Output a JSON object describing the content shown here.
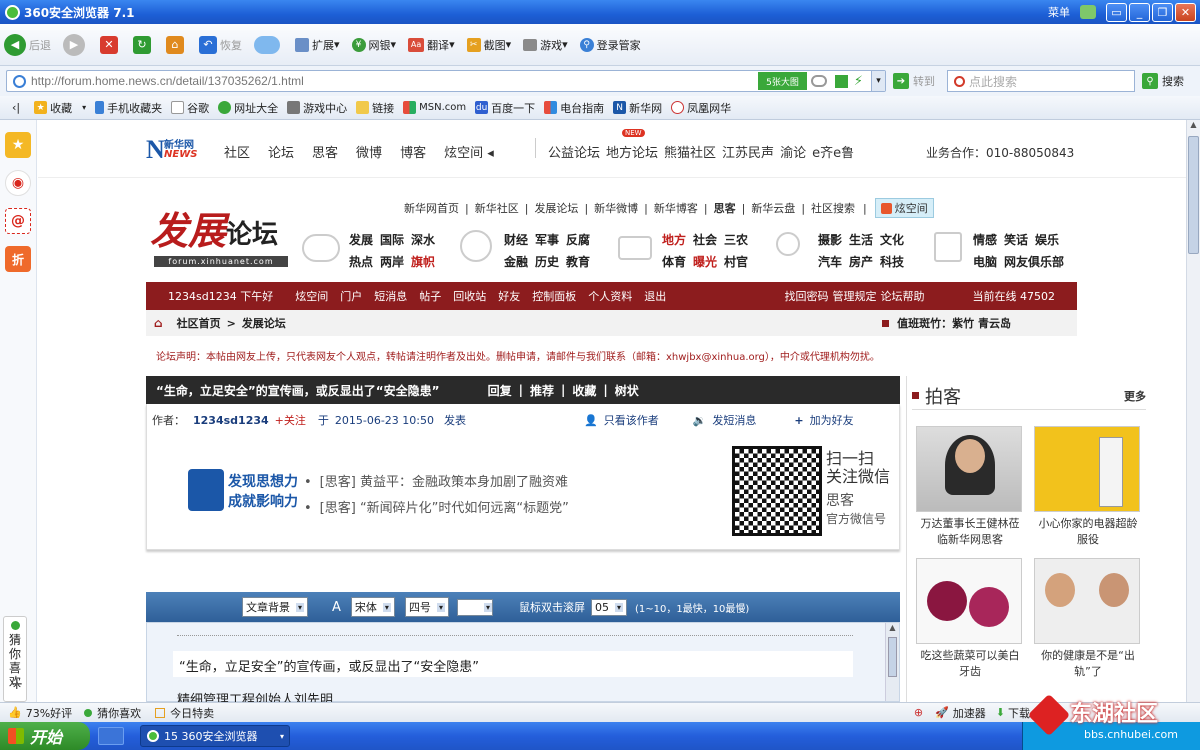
{
  "window": {
    "title": "360安全浏览器 7.1",
    "menu_label": "菜单"
  },
  "toolbar": {
    "back": "后退",
    "restore": "恢复",
    "extend": "扩展",
    "netbank": "网银",
    "translate": "翻译",
    "screenshot": "截图",
    "games": "游戏",
    "login": "登录管家"
  },
  "address": {
    "url": "http://forum.home.news.cn/detail/137035262/1.html",
    "big_image_btn": "5张大图",
    "go": "转到",
    "search_placeholder": "点此搜索",
    "search_btn": "搜索"
  },
  "favorites": [
    "收藏",
    "手机收藏夹",
    "谷歌",
    "网址大全",
    "游戏中心",
    "链接",
    "MSN.com",
    "百度一下",
    "电台指南",
    "新华网",
    "凤凰网华"
  ],
  "site": {
    "logo_text": "新华网",
    "logo_sub": "NEWS",
    "nav": [
      "社区",
      "论坛",
      "思客",
      "微博",
      "博客",
      "炫空间 ◂"
    ],
    "nav2": [
      "公益论坛",
      "地方论坛",
      "熊猫社区",
      "江苏民声",
      "渝论",
      "e齐e鲁"
    ],
    "new_badge": "NEW",
    "biz": "业务合作：010-88050843",
    "toplinks": [
      "新华网首页",
      "新华社区",
      "发展论坛",
      "新华微博",
      "新华博客",
      "思客",
      "新华云盘",
      "社区搜索"
    ],
    "xuankongjian": "炫空间",
    "forum_logo_red": "发展",
    "forum_logo_black": "论坛",
    "forum_domain": "forum.xinhuanet.com",
    "cat1": [
      [
        "发展",
        "国际",
        "深水"
      ],
      [
        "热点",
        "两岸",
        "旗帜"
      ]
    ],
    "cat2": [
      [
        "财经",
        "军事",
        "反腐"
      ],
      [
        "金融",
        "历史",
        "教育"
      ]
    ],
    "cat3": [
      [
        "地方",
        "社会",
        "三农"
      ],
      [
        "体育",
        "曝光",
        "村官"
      ]
    ],
    "cat4": [
      [
        "摄影",
        "生活",
        "文化"
      ],
      [
        "汽车",
        "房产",
        "科技"
      ]
    ],
    "cat5": [
      [
        "情感",
        "笑话",
        "娱乐"
      ],
      [
        "电脑",
        "网友俱乐部"
      ]
    ],
    "userbar": [
      "1234sd1234 下午好",
      "炫空间",
      "门户",
      "短消息",
      "帖子",
      "回收站",
      "好友",
      "控制面板",
      "个人资料",
      "退出"
    ],
    "userbar_right": [
      "找回密码",
      "管理规定",
      "论坛帮助"
    ],
    "online": "当前在线 47502",
    "breadcrumb_home": "社区首页",
    "breadcrumb_arrow": ">",
    "breadcrumb_cur": "发展论坛",
    "duty": "值班斑竹：紫竹  青云岛",
    "notice": "论坛声明：本帖由网友上传，只代表网友个人观点，转帖请注明作者及出处。删帖申请，请邮件与我们联系（邮箱：xhwjbx@xinhua.org），中介或代理机构勿扰。"
  },
  "post": {
    "title": "“生命，立足安全”的宣传画，或反显出了“安全隐患”",
    "actions": [
      "回复",
      "推荐",
      "收藏",
      "树状"
    ],
    "author_label": "作者：",
    "author": "1234sd1234",
    "follow": "+关注",
    "at": "于",
    "time": "2015-06-23 10:50",
    "publish": "发表",
    "only_author": "只看该作者",
    "send_msg": "发短消息",
    "add_friend": "加为好友",
    "banner_title1": "发现思想力",
    "banner_title2": "成就影响力",
    "banner_items": [
      "[思客] 黄益平：金融政策本身加剧了融资难",
      "[思客] “新闻碎片化”时代如何远离“标题党”"
    ],
    "qr_text1": "扫一扫",
    "qr_text2": "关注微信",
    "qr_text3": "思客",
    "qr_text4": "官方微信号",
    "reader_bg": "文章背景",
    "font_a": "A",
    "font_name": "宋体",
    "font_size": "四号",
    "scroll_label": "鼠标双击滚屏",
    "scroll_val": "05",
    "scroll_hint": "(1~10，1最快，10最慢)",
    "body_title": "“生命，立足安全”的宣传画，或反显出了“安全隐患”",
    "body_line2": "精细管理工程创始人刘先明"
  },
  "sidebar": {
    "title": "拍客",
    "more": "更多",
    "items": [
      "万达董事长王健林莅临新华网思客",
      "小心你家的电器超龄服役",
      "吃这些蔬菜可以美白牙齿",
      "你的健康是不是“出轨”了"
    ]
  },
  "dock": {
    "guess": "猜你喜欢",
    "plus": "+"
  },
  "status": {
    "rating": "73%好评",
    "guess": "猜你喜欢",
    "deal": "今日特卖",
    "accelerator": "加速器",
    "download": "下载"
  },
  "taskbar": {
    "start": "开始",
    "task": "15 360安全浏览器",
    "watermark": "东湖社区",
    "watermark_url": "bbs.cnhubei.com"
  }
}
